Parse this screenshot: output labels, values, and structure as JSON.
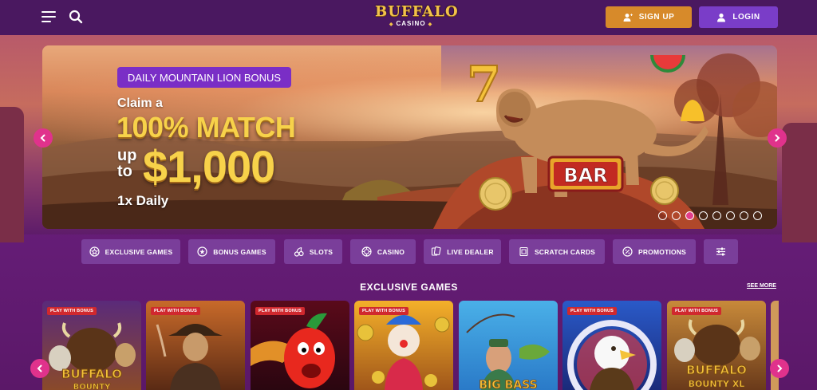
{
  "header": {
    "logo_main": "BUFFALO",
    "logo_sub": "CASINO",
    "signup_label": "SIGN UP",
    "login_label": "LOGIN",
    "icons": [
      "hamburger-icon",
      "search-icon",
      "user-plus-icon",
      "user-icon"
    ]
  },
  "banner": {
    "tag": "DAILY MOUNTAIN LION BONUS",
    "claim": "Claim a",
    "match": "100% MATCH",
    "up_to": "up to",
    "amount": "$1,000",
    "daily": "1x Daily",
    "slide_count": 8,
    "active_slide": 3,
    "mascot_text": "BAR"
  },
  "categories": [
    {
      "label": "EXCLUSIVE GAMES",
      "icon": "star-badge-icon"
    },
    {
      "label": "BONUS GAMES",
      "icon": "star-circle-icon"
    },
    {
      "label": "SLOTS",
      "icon": "cherries-icon"
    },
    {
      "label": "CASINO",
      "icon": "chip-icon"
    },
    {
      "label": "LIVE DEALER",
      "icon": "cards-icon"
    },
    {
      "label": "SCRATCH CARDS",
      "icon": "ticket-icon"
    },
    {
      "label": "PROMOTIONS",
      "icon": "percent-icon"
    },
    {
      "label": "",
      "icon": "filter-sliders-icon"
    }
  ],
  "section": {
    "title": "EXCLUSIVE GAMES",
    "see_more": "SEE MORE"
  },
  "games": [
    {
      "badge": "PLAY WITH BONUS",
      "art_text": "BUFFALO",
      "art_sub": "BOUNTY"
    },
    {
      "badge": "PLAY WITH BONUS",
      "art_text": "",
      "art_sub": ""
    },
    {
      "badge": "PLAY WITH BONUS",
      "art_text": "",
      "art_sub": ""
    },
    {
      "badge": "PLAY WITH BONUS",
      "art_text": "",
      "art_sub": ""
    },
    {
      "badge": "",
      "art_text": "BIG BASS",
      "art_sub": ""
    },
    {
      "badge": "PLAY WITH BONUS",
      "art_text": "",
      "art_sub": ""
    },
    {
      "badge": "PLAY WITH BONUS",
      "art_text": "BUFFALO",
      "art_sub": "BOUNTY XL"
    }
  ],
  "colors": {
    "header_bg": "#4a1860",
    "signup": "#d78a2a",
    "login": "#7a3dc8",
    "accent_pink": "#e0328c",
    "gold": "#f7d24a",
    "nav_btn": "#7a3e9a",
    "badge_red": "#d0282e"
  }
}
